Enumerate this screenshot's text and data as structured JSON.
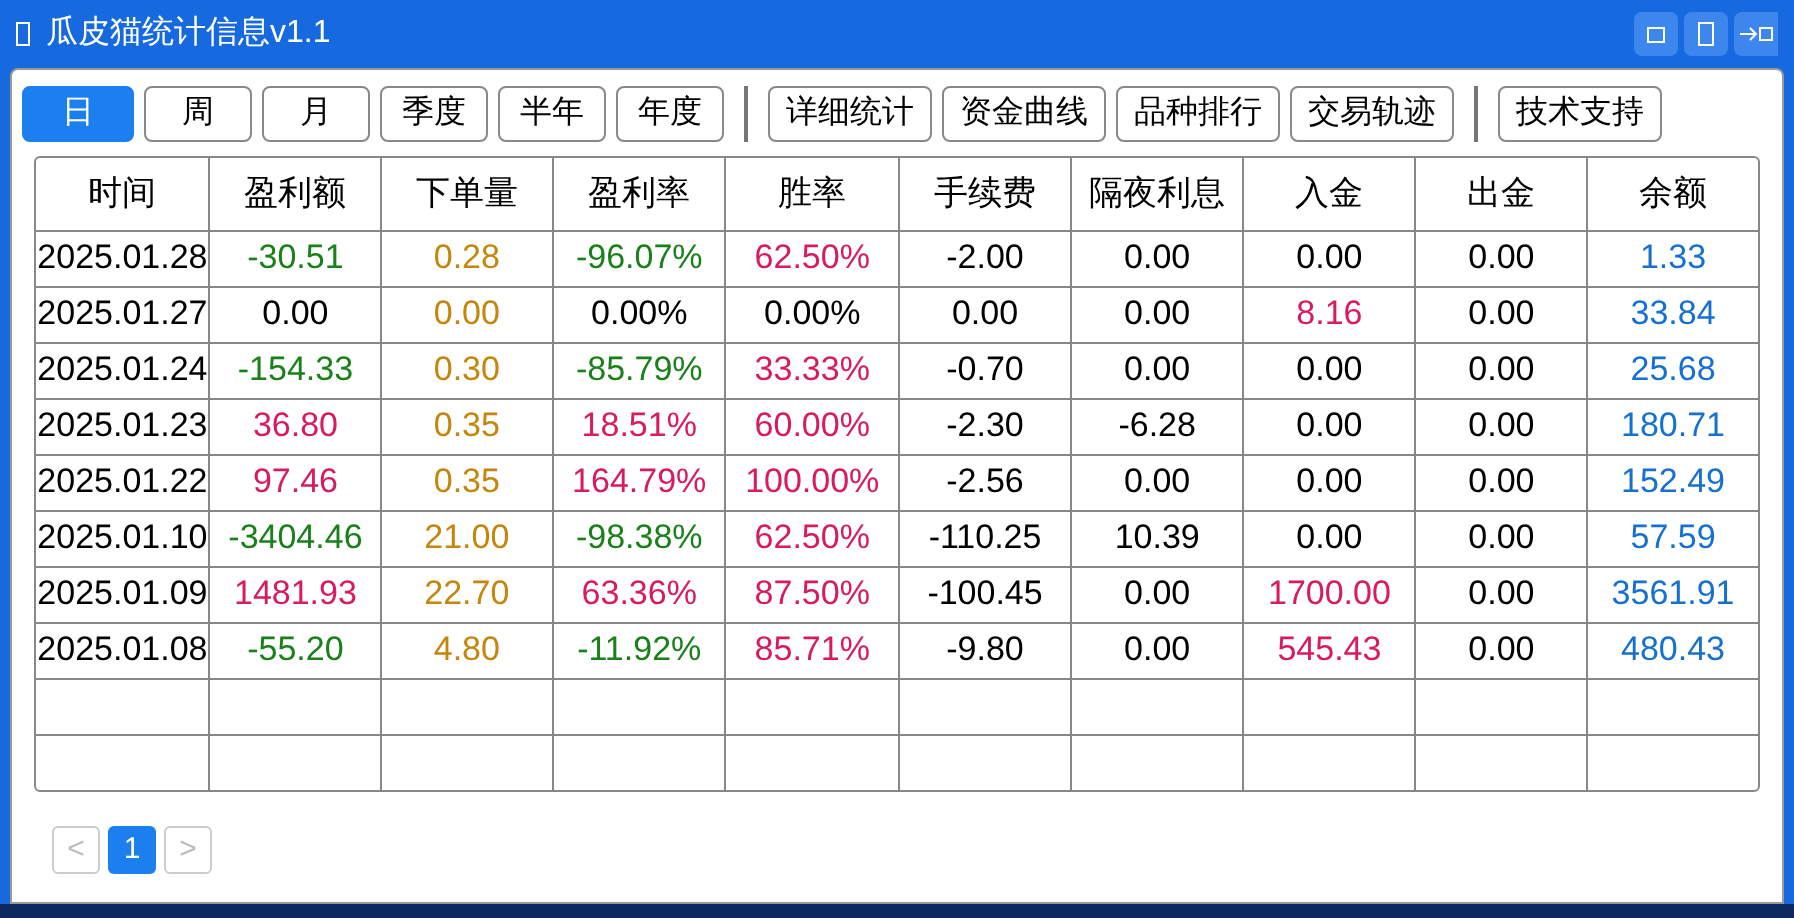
{
  "window": {
    "title": "瓜皮猫统计信息v1.1"
  },
  "period_tabs": [
    {
      "label": "日",
      "selected": true
    },
    {
      "label": "周",
      "selected": false
    },
    {
      "label": "月",
      "selected": false
    },
    {
      "label": "季度",
      "selected": false
    },
    {
      "label": "半年",
      "selected": false
    },
    {
      "label": "年度",
      "selected": false
    }
  ],
  "view_buttons": [
    "详细统计",
    "资金曲线",
    "品种排行",
    "交易轨迹"
  ],
  "support_buttons": [
    "技术支持"
  ],
  "table": {
    "columns": [
      "时间",
      "盈利额",
      "下单量",
      "盈利率",
      "胜率",
      "手续费",
      "隔夜利息",
      "入金",
      "出金",
      "余额"
    ],
    "rows": [
      [
        {
          "text": "2025.01.28",
          "color": "#000000"
        },
        {
          "text": "-30.51",
          "color": "#1a801a"
        },
        {
          "text": "0.28",
          "color": "#c4860c"
        },
        {
          "text": "-96.07%",
          "color": "#1a801a"
        },
        {
          "text": "62.50%",
          "color": "#d81b60"
        },
        {
          "text": "-2.00",
          "color": "#000000"
        },
        {
          "text": "0.00",
          "color": "#000000"
        },
        {
          "text": "0.00",
          "color": "#000000"
        },
        {
          "text": "0.00",
          "color": "#000000"
        },
        {
          "text": "1.33",
          "color": "#1670d0"
        }
      ],
      [
        {
          "text": "2025.01.27",
          "color": "#000000"
        },
        {
          "text": "0.00",
          "color": "#000000"
        },
        {
          "text": "0.00",
          "color": "#c4860c"
        },
        {
          "text": "0.00%",
          "color": "#000000"
        },
        {
          "text": "0.00%",
          "color": "#000000"
        },
        {
          "text": "0.00",
          "color": "#000000"
        },
        {
          "text": "0.00",
          "color": "#000000"
        },
        {
          "text": "8.16",
          "color": "#d81b60"
        },
        {
          "text": "0.00",
          "color": "#000000"
        },
        {
          "text": "33.84",
          "color": "#1670d0"
        }
      ],
      [
        {
          "text": "2025.01.24",
          "color": "#000000"
        },
        {
          "text": "-154.33",
          "color": "#1a801a"
        },
        {
          "text": "0.30",
          "color": "#c4860c"
        },
        {
          "text": "-85.79%",
          "color": "#1a801a"
        },
        {
          "text": "33.33%",
          "color": "#d81b60"
        },
        {
          "text": "-0.70",
          "color": "#000000"
        },
        {
          "text": "0.00",
          "color": "#000000"
        },
        {
          "text": "0.00",
          "color": "#000000"
        },
        {
          "text": "0.00",
          "color": "#000000"
        },
        {
          "text": "25.68",
          "color": "#1670d0"
        }
      ],
      [
        {
          "text": "2025.01.23",
          "color": "#000000"
        },
        {
          "text": "36.80",
          "color": "#d81b60"
        },
        {
          "text": "0.35",
          "color": "#c4860c"
        },
        {
          "text": "18.51%",
          "color": "#d81b60"
        },
        {
          "text": "60.00%",
          "color": "#d81b60"
        },
        {
          "text": "-2.30",
          "color": "#000000"
        },
        {
          "text": "-6.28",
          "color": "#000000"
        },
        {
          "text": "0.00",
          "color": "#000000"
        },
        {
          "text": "0.00",
          "color": "#000000"
        },
        {
          "text": "180.71",
          "color": "#1670d0"
        }
      ],
      [
        {
          "text": "2025.01.22",
          "color": "#000000"
        },
        {
          "text": "97.46",
          "color": "#d81b60"
        },
        {
          "text": "0.35",
          "color": "#c4860c"
        },
        {
          "text": "164.79%",
          "color": "#d81b60"
        },
        {
          "text": "100.00%",
          "color": "#d81b60"
        },
        {
          "text": "-2.56",
          "color": "#000000"
        },
        {
          "text": "0.00",
          "color": "#000000"
        },
        {
          "text": "0.00",
          "color": "#000000"
        },
        {
          "text": "0.00",
          "color": "#000000"
        },
        {
          "text": "152.49",
          "color": "#1670d0"
        }
      ],
      [
        {
          "text": "2025.01.10",
          "color": "#000000"
        },
        {
          "text": "-3404.46",
          "color": "#1a801a"
        },
        {
          "text": "21.00",
          "color": "#c4860c"
        },
        {
          "text": "-98.38%",
          "color": "#1a801a"
        },
        {
          "text": "62.50%",
          "color": "#d81b60"
        },
        {
          "text": "-110.25",
          "color": "#000000"
        },
        {
          "text": "10.39",
          "color": "#000000"
        },
        {
          "text": "0.00",
          "color": "#000000"
        },
        {
          "text": "0.00",
          "color": "#000000"
        },
        {
          "text": "57.59",
          "color": "#1670d0"
        }
      ],
      [
        {
          "text": "2025.01.09",
          "color": "#000000"
        },
        {
          "text": "1481.93",
          "color": "#d81b60"
        },
        {
          "text": "22.70",
          "color": "#c4860c"
        },
        {
          "text": "63.36%",
          "color": "#d81b60"
        },
        {
          "text": "87.50%",
          "color": "#d81b60"
        },
        {
          "text": "-100.45",
          "color": "#000000"
        },
        {
          "text": "0.00",
          "color": "#000000"
        },
        {
          "text": "1700.00",
          "color": "#d81b60"
        },
        {
          "text": "0.00",
          "color": "#000000"
        },
        {
          "text": "3561.91",
          "color": "#1670d0"
        }
      ],
      [
        {
          "text": "2025.01.08",
          "color": "#000000"
        },
        {
          "text": "-55.20",
          "color": "#1a801a"
        },
        {
          "text": "4.80",
          "color": "#c4860c"
        },
        {
          "text": "-11.92%",
          "color": "#1a801a"
        },
        {
          "text": "85.71%",
          "color": "#d81b60"
        },
        {
          "text": "-9.80",
          "color": "#000000"
        },
        {
          "text": "0.00",
          "color": "#000000"
        },
        {
          "text": "545.43",
          "color": "#d81b60"
        },
        {
          "text": "0.00",
          "color": "#000000"
        },
        {
          "text": "480.43",
          "color": "#1670d0"
        }
      ]
    ]
  },
  "pagination": {
    "prev": {
      "label": "<",
      "disabled": true
    },
    "pages": [
      {
        "label": "1",
        "selected": true
      }
    ],
    "next": {
      "label": ">",
      "disabled": true
    }
  }
}
